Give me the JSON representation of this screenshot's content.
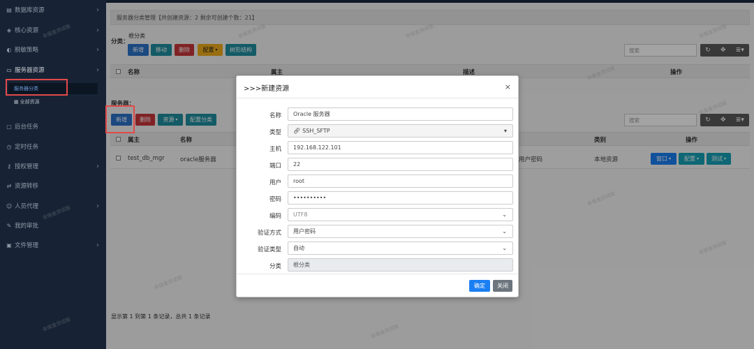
{
  "sidebar": {
    "items": [
      {
        "label": "数据库资源",
        "icon": "database-icon"
      },
      {
        "label": "核心资源",
        "icon": "core-icon"
      },
      {
        "label": "脱敏策略",
        "icon": "mask-icon"
      },
      {
        "label": "服务器资源",
        "icon": "monitor-icon"
      },
      {
        "label": "后台任务",
        "icon": "task-icon"
      },
      {
        "label": "定时任务",
        "icon": "clock-icon"
      },
      {
        "label": "授权管理",
        "icon": "key-icon"
      },
      {
        "label": "资源转移",
        "icon": "transfer-icon"
      },
      {
        "label": "人员代理",
        "icon": "people-icon"
      },
      {
        "label": "我的审批",
        "icon": "approval-icon"
      },
      {
        "label": "文件管理",
        "icon": "folder-icon"
      }
    ],
    "sub_items": [
      {
        "label": "服务器分类"
      },
      {
        "label": "全部资源"
      }
    ]
  },
  "main": {
    "panel_title": "服务器分类管理【共创建资源：2   剩余可创建个数：21】",
    "category_section": {
      "label": "分类：",
      "root": "根分类",
      "buttons": {
        "add": "新增",
        "move": "移动",
        "delete": "删除",
        "config": "配置",
        "tree": "树形结构"
      },
      "search_placeholder": "搜索",
      "columns": {
        "name": "名称",
        "attr": "属主",
        "desc": "描述",
        "ops": "操作"
      }
    },
    "server_section": {
      "label": "服务器：",
      "buttons": {
        "add": "新增",
        "delete": "删除",
        "resource": "资源",
        "config_cat": "配置分类"
      },
      "search_placeholder": "搜索",
      "columns": {
        "owner": "属主",
        "name": "名称",
        "type": "类别",
        "ops": "操作"
      },
      "row": {
        "owner": "test_db_mgr",
        "name": "oracle服务器",
        "auth": "用户密码",
        "type": "本地资源",
        "btn_window": "窗口",
        "btn_config": "配置",
        "btn_test": "测试"
      }
    },
    "footer": "显示第 1 到第 1 条记录，总共 1 条记录"
  },
  "modal": {
    "title": ">>>新建资源",
    "fields": {
      "name": {
        "label": "名称",
        "value": "Oracle 服务器"
      },
      "type": {
        "label": "类型",
        "value": "SSH_SFTP"
      },
      "host": {
        "label": "主机",
        "value": "192.168.122.101"
      },
      "port": {
        "label": "端口",
        "value": "22"
      },
      "user": {
        "label": "用户",
        "value": "root"
      },
      "password": {
        "label": "密码",
        "value": "••••••••••"
      },
      "encoding": {
        "label": "编码",
        "value": "UTF8"
      },
      "auth_method": {
        "label": "验证方式",
        "value": "用户密码"
      },
      "auth_type": {
        "label": "验证类型",
        "value": "自动"
      },
      "category": {
        "label": "分类",
        "value": "根分类"
      }
    },
    "confirm": "确定",
    "close": "关闭"
  },
  "watermark": "非保金测试版",
  "colors": {
    "sidebar": "#1c2a3f",
    "primary": "#1a7ff2",
    "danger": "#c9363a",
    "teal": "#17a2b8",
    "warning": "#f0ad1c"
  }
}
